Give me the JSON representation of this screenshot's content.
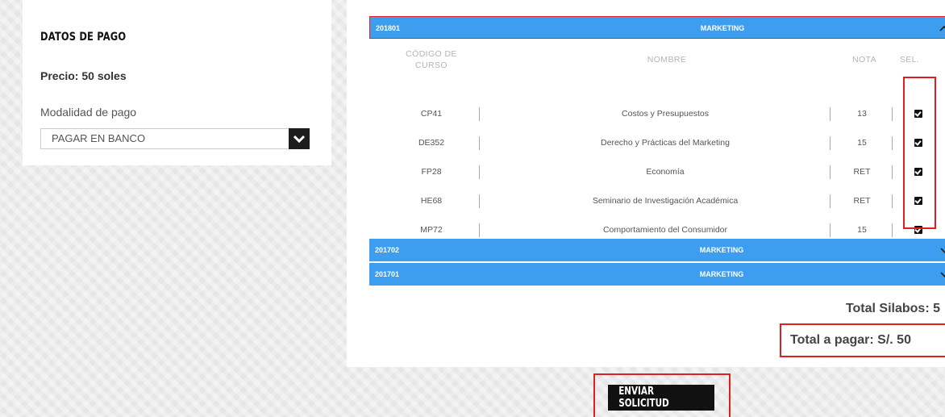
{
  "payment": {
    "title": "DATOS DE PAGO",
    "price": "Precio: 50 soles",
    "mode_label": "Modalidad de pago",
    "mode_value": "PAGAR EN BANCO"
  },
  "periods": [
    {
      "year": "201801",
      "program": "MARKETING",
      "expanded": true
    },
    {
      "year": "201702",
      "program": "MARKETING",
      "expanded": false
    },
    {
      "year": "201701",
      "program": "MARKETING",
      "expanded": false
    }
  ],
  "table": {
    "headers": {
      "code": "CÓDIGO DE CURSO",
      "name": "NOMBRE",
      "grade": "NOTA",
      "sel": "SEL."
    },
    "rows": [
      {
        "code": "CP41",
        "name": "Costos y Presupuestos",
        "grade": "13",
        "selected": true
      },
      {
        "code": "DE352",
        "name": "Derecho y Prácticas del Marketing",
        "grade": "15",
        "selected": true
      },
      {
        "code": "FP28",
        "name": "Economía",
        "grade": "RET",
        "selected": true
      },
      {
        "code": "HE68",
        "name": "Seminario de Investigación Académica",
        "grade": "RET",
        "selected": true
      },
      {
        "code": "MP72",
        "name": "Comportamiento del Consumidor",
        "grade": "15",
        "selected": true
      }
    ]
  },
  "totals": {
    "silabos": "Total Silabos: 5",
    "pagar": "Total a pagar: S/. 50"
  },
  "actions": {
    "send": "ENVIAR SOLICITUD"
  },
  "colors": {
    "accent": "#3d9ef0",
    "highlight": "#e02020",
    "button": "#111111"
  }
}
